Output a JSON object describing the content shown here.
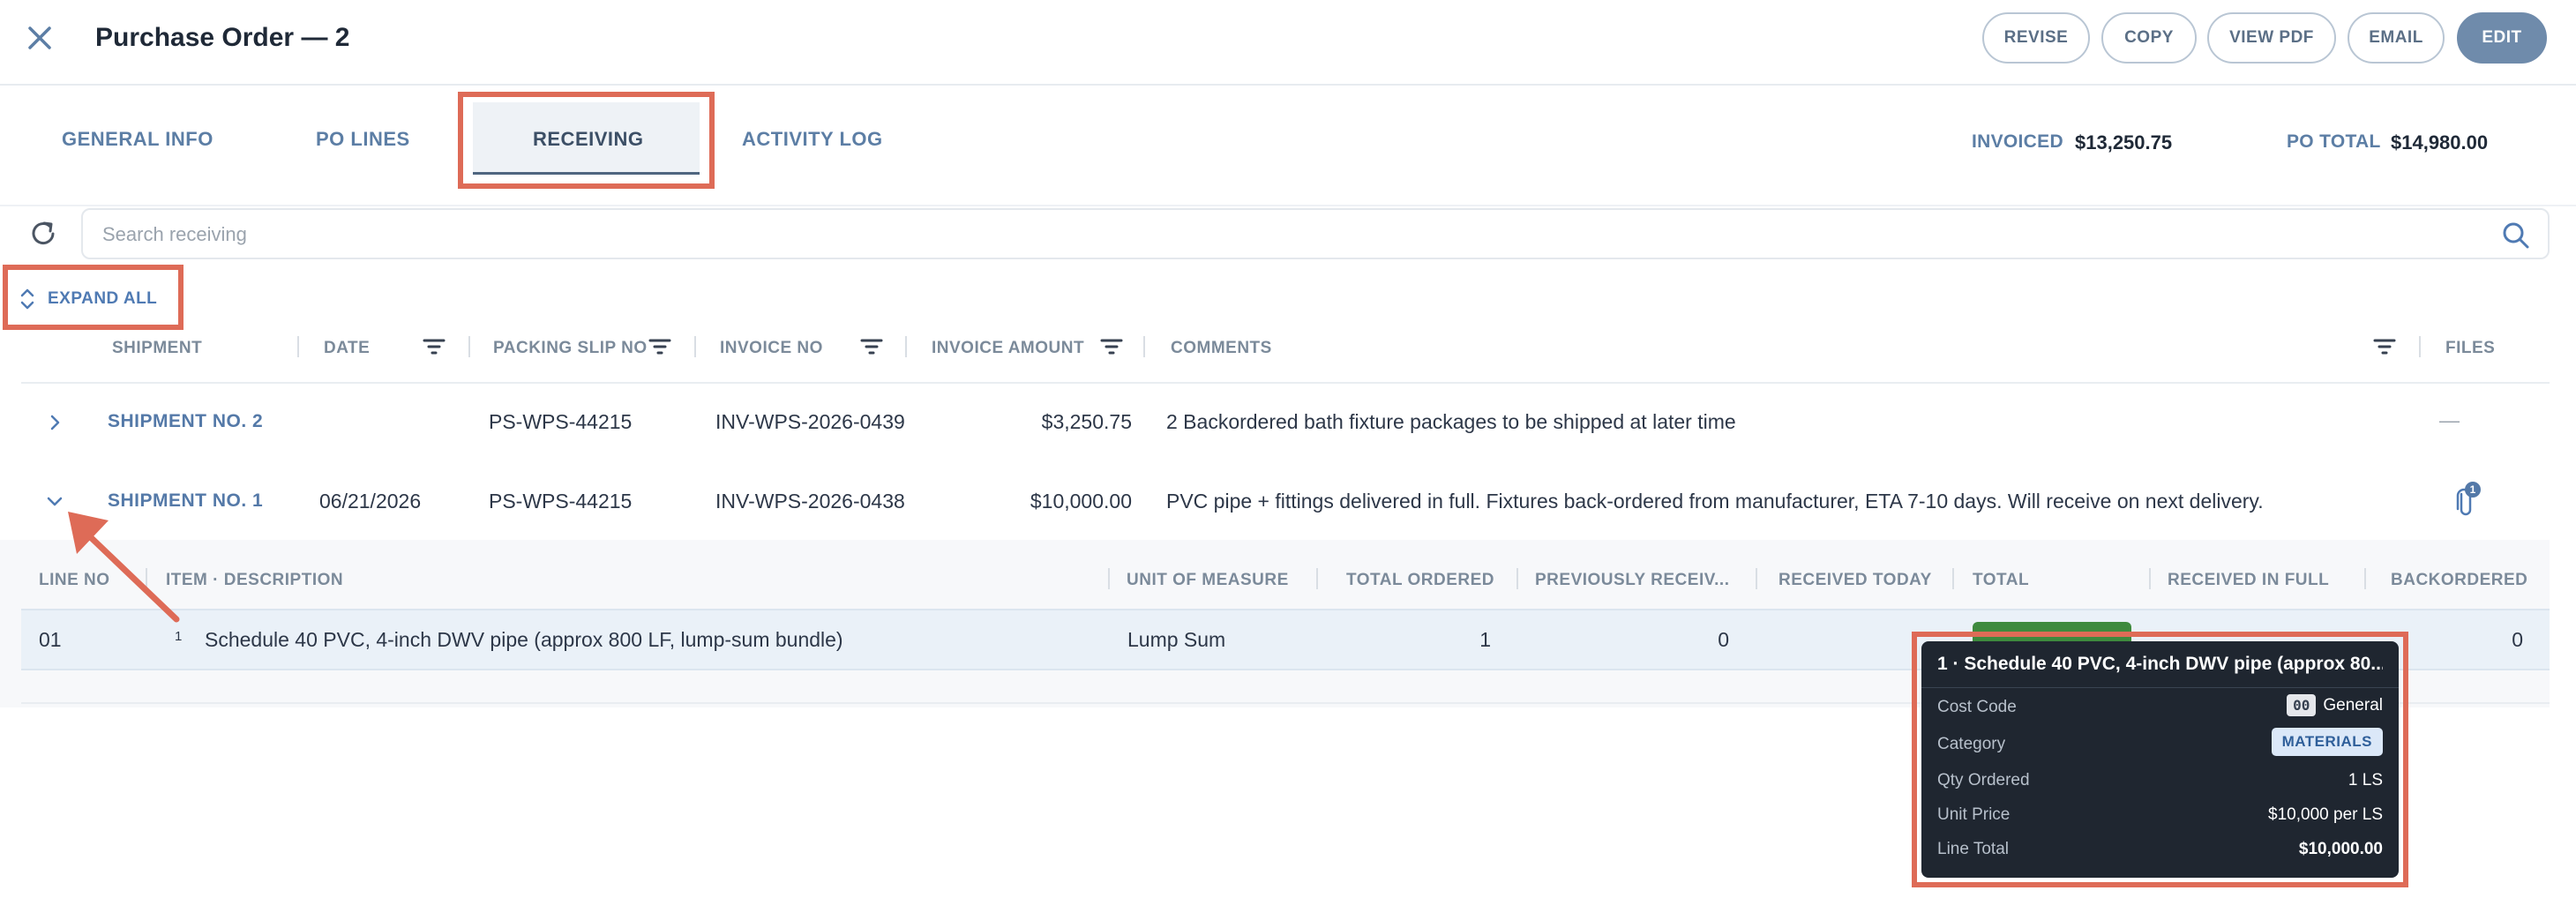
{
  "header": {
    "title": "Purchase Order — 2",
    "actions": [
      "REVISE",
      "COPY",
      "VIEW PDF",
      "EMAIL",
      "EDIT"
    ]
  },
  "tabs": [
    "GENERAL INFO",
    "PO LINES",
    "RECEIVING",
    "ACTIVITY LOG"
  ],
  "active_tab": "RECEIVING",
  "summary": {
    "invoiced_label": "INVOICED",
    "invoiced_value": "$13,250.75",
    "po_total_label": "PO TOTAL",
    "po_total_value": "$14,980.00"
  },
  "search": {
    "placeholder": "Search receiving",
    "value": ""
  },
  "expand_all_label": "EXPAND ALL",
  "columns": {
    "shipment": "SHIPMENT",
    "date": "DATE",
    "packing_slip": "PACKING SLIP NO",
    "invoice_no": "INVOICE NO",
    "invoice_amount": "INVOICE AMOUNT",
    "comments": "COMMENTS",
    "files": "FILES"
  },
  "shipments": [
    {
      "name": "SHIPMENT NO. 2",
      "date": "",
      "packing_slip": "PS-WPS-44215",
      "invoice_no": "INV-WPS-2026-0439",
      "invoice_amount": "$3,250.75",
      "comments": "2 Backordered bath fixture packages to be shipped at later time",
      "files": "—",
      "expanded": false
    },
    {
      "name": "SHIPMENT NO. 1",
      "date": "06/21/2026",
      "packing_slip": "PS-WPS-44215",
      "invoice_no": "INV-WPS-2026-0438",
      "invoice_amount": "$10,000.00",
      "comments": "PVC pipe + fittings delivered in full. Fixtures back-ordered from manufacturer, ETA 7-10 days. Will receive on next delivery.",
      "files_count": "1",
      "expanded": true
    }
  ],
  "line_columns": {
    "line_no": "LINE NO",
    "item": "ITEM · DESCRIPTION",
    "uom": "UNIT OF MEASURE",
    "total_ordered": "TOTAL ORDERED",
    "previously_received": "PREVIOUSLY RECEIV...",
    "received_today": "RECEIVED TODAY",
    "total": "TOTAL",
    "received_in_full": "RECEIVED IN FULL",
    "backordered": "BACKORDERED"
  },
  "lines": [
    {
      "line_no": "01",
      "item_index": "1",
      "description": "Schedule 40 PVC, 4-inch DWV pipe (approx 800 LF, lump-sum bundle)",
      "uom": "Lump Sum",
      "total_ordered": "1",
      "previously_received": "0",
      "backordered": "0"
    }
  ],
  "tooltip": {
    "title": "1 · Schedule 40 PVC, 4-inch DWV pipe (approx 80...",
    "cost_code_label": "Cost Code",
    "cost_code": "00",
    "cost_code_name": "General",
    "category_label": "Category",
    "category": "MATERIALS",
    "qty_label": "Qty Ordered",
    "qty": "1 LS",
    "unit_price_label": "Unit Price",
    "unit_price": "$10,000 per LS",
    "line_total_label": "Line Total",
    "line_total": "$10,000.00"
  },
  "colors": {
    "accent": "#5c7ea5",
    "highlight": "#de6b57",
    "edit_button": "#6f8bab",
    "tooltip_bg": "#1f2630",
    "total_pill": "#3e8a3e"
  },
  "icons": [
    "close-icon",
    "refresh-icon",
    "search-icon",
    "expand-collapse-icon",
    "filter-icon",
    "chevron-right-icon",
    "chevron-down-icon",
    "paperclip-icon"
  ]
}
